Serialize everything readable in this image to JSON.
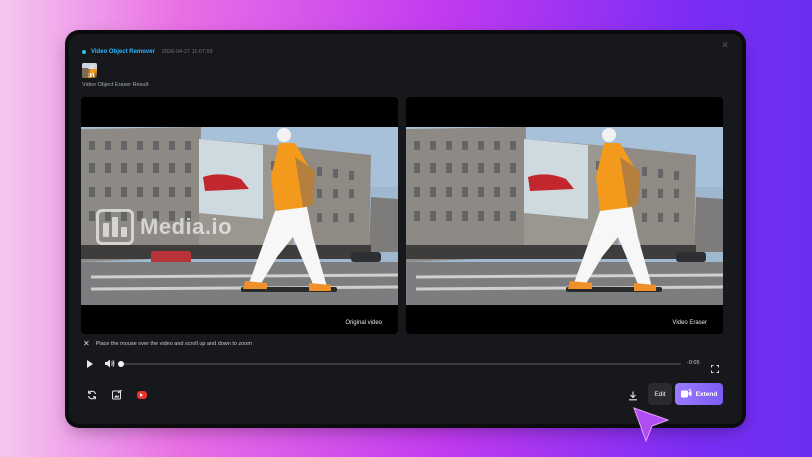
{
  "header": {
    "tool_name": "Video Object Remover",
    "timestamp": "2026-04-27 11:07:59",
    "subtitle": "Video Object Eraser Result"
  },
  "panels": {
    "left_label": "Original video",
    "right_label": "Video Eraser",
    "watermark_text": "Media.io"
  },
  "hint": {
    "text": "Place the mouse over the video and scroll up and down to zoom"
  },
  "player": {
    "time": "-0:05",
    "progress": 0
  },
  "actions": {
    "edit_label": "Edit",
    "extend_label": "Extend"
  },
  "icons": {
    "close": "close-icon",
    "play": "play-icon",
    "volume": "volume-icon",
    "fullscreen": "fullscreen-icon",
    "regenerate": "refresh-icon",
    "image_edit": "image-edit-icon",
    "youtube": "youtube-icon",
    "download": "download-icon",
    "extend": "extend-icon",
    "pointer": "cursor-arrow-icon"
  },
  "colors": {
    "accent": "#2fb6ff",
    "extend_button": "#8a6cfb",
    "window_bg": "#17181b"
  }
}
